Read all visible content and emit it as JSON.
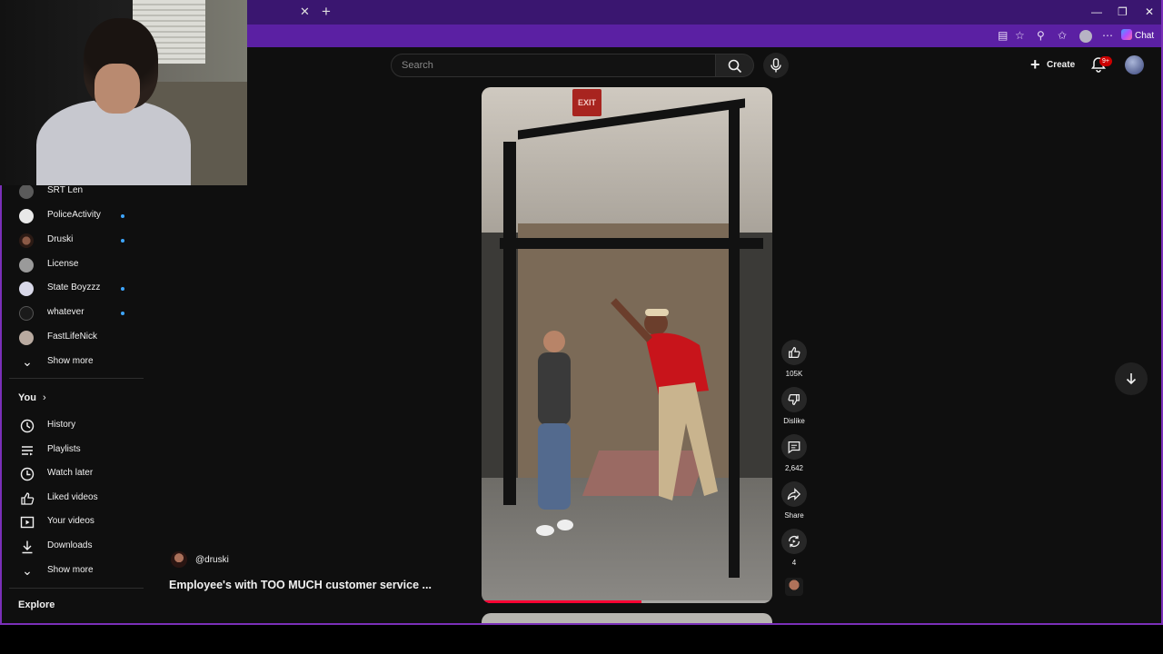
{
  "browser": {
    "chat_label": "Chat"
  },
  "search": {
    "placeholder": "Search"
  },
  "header": {
    "create_label": "Create",
    "notifications_badge": "9+"
  },
  "sidebar": {
    "subscriptions": [
      {
        "label": "SRT Len",
        "new": false
      },
      {
        "label": "PoliceActivity",
        "new": true
      },
      {
        "label": "Druski",
        "new": true
      },
      {
        "label": "License",
        "new": false
      },
      {
        "label": "State Boyzzz",
        "new": true
      },
      {
        "label": "whatever",
        "new": true
      },
      {
        "label": "FastLifeNick",
        "new": false
      }
    ],
    "subs_show_more": "Show more",
    "you_heading": "You",
    "you_items": [
      {
        "label": "History",
        "icon": "history-icon"
      },
      {
        "label": "Playlists",
        "icon": "playlists-icon"
      },
      {
        "label": "Watch later",
        "icon": "watch-later-icon"
      },
      {
        "label": "Liked videos",
        "icon": "liked-videos-icon"
      },
      {
        "label": "Your videos",
        "icon": "your-videos-icon"
      },
      {
        "label": "Downloads",
        "icon": "downloads-icon"
      }
    ],
    "you_show_more": "Show more",
    "explore_heading": "Explore"
  },
  "short": {
    "channel": "@druski",
    "title": "Employee's with TOO MUCH customer service ...",
    "exit_sign": "EXIT",
    "progress": 0.55,
    "actions": {
      "like_count": "105K",
      "dislike_label": "Dislike",
      "comment_count": "2,642",
      "share_label": "Share",
      "remix_count": "4"
    }
  },
  "colors": {
    "accent_purple": "#7a2fb8",
    "progress_red": "#ff0033",
    "badge_red": "#cc0000",
    "new_dot_blue": "#3ea6ff"
  }
}
